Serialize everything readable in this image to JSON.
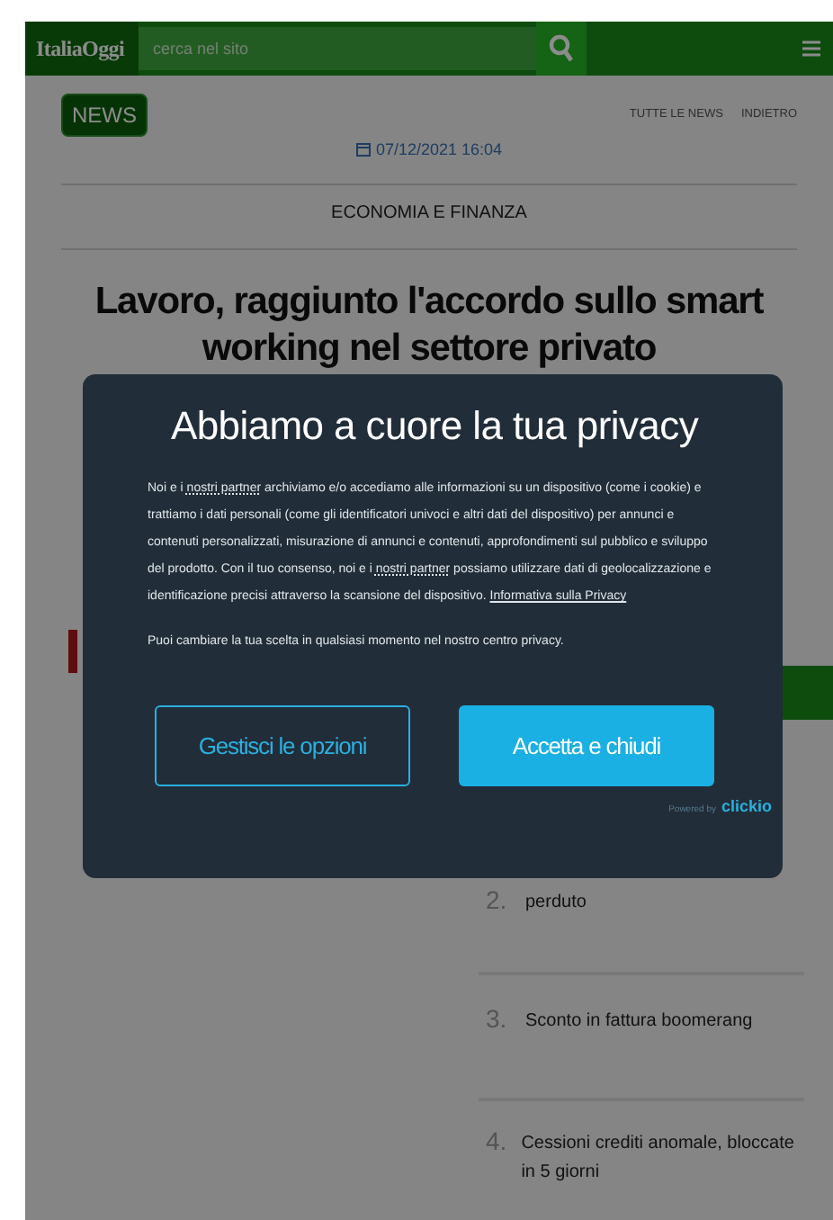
{
  "top_bar": {
    "logo": "ItaliaOggi",
    "search": {
      "placeholder": "cerca nel sito"
    }
  },
  "article": {
    "section_badge": "NEWS",
    "nav_links": [
      "TUTTE LE NEWS",
      "INDIETRO"
    ],
    "date": "07/12/2021 16:04",
    "category": "ECONOMIA E FINANZA",
    "headline": "Lavoro, raggiunto l'accordo sullo smart working nel settore privato"
  },
  "most_read": [
    {
      "number": "2.",
      "title": "perduto"
    },
    {
      "number": "3.",
      "title": "Sconto in fattura boomerang"
    },
    {
      "number": "4.",
      "title": "Cessioni crediti anomale, bloccate in 5 giorni"
    }
  ],
  "privacy_dialog": {
    "title": "Abbiamo a cuore la tua privacy",
    "body": [
      {
        "kind": "text",
        "text": "Noi e i "
      },
      {
        "kind": "link",
        "text": "nostri partner"
      },
      {
        "kind": "text",
        "text": " archiviamo e/o accediamo alle informazioni su un dispositivo (come i cookie) e trattiamo i dati personali (come gli identificatori univoci e altri dati del dispositivo) per annunci e contenuti personalizzati, misurazione di annunci e contenuti, approfondimenti sul pubblico e sviluppo del prodotto. Con il tuo consenso, noi e i "
      },
      {
        "kind": "link",
        "text": "nostri partner"
      },
      {
        "kind": "text",
        "text": " possiamo utilizzare dati di geolocalizzazione e identificazione precisi attraverso la scansione del dispositivo. "
      },
      {
        "kind": "link",
        "text": "Informativa sulla Privacy"
      }
    ],
    "note": "Puoi cambiare la tua scelta in qualsiasi momento nel nostro centro privacy.",
    "buttons": [
      {
        "label": "Gestisci le opzioni",
        "kind": "secondary"
      },
      {
        "label": "Accetta e chiudi",
        "kind": "primary"
      }
    ],
    "powered_by": "Powered by",
    "brand": "clickio"
  }
}
